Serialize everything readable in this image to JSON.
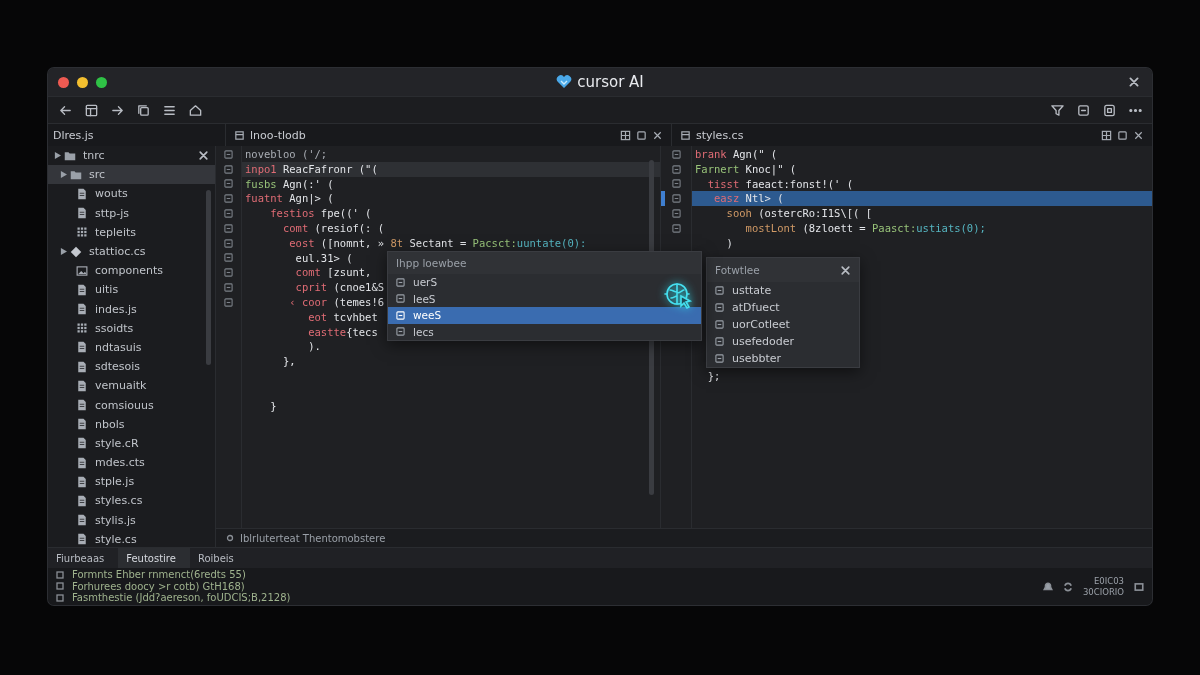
{
  "window": {
    "title": "cursor AI"
  },
  "sidebar": {
    "title": "Dlres.js",
    "tree": [
      {
        "label": "tnrc",
        "kind": "folder",
        "selected": false,
        "closable": true,
        "children": [
          {
            "label": "src",
            "kind": "folder",
            "selected": true,
            "children": [
              {
                "label": "wouts",
                "kind": "file",
                "selected": false
              },
              {
                "label": "sttp-js",
                "kind": "file",
                "selected": false
              },
              {
                "label": "tepleits",
                "kind": "grid",
                "selected": false
              }
            ]
          },
          {
            "label": "stattioc.cs",
            "kind": "diamond",
            "selected": false,
            "children": [
              {
                "label": "components",
                "kind": "image",
                "selected": false
              },
              {
                "label": "uitis",
                "kind": "file",
                "selected": false
              },
              {
                "label": "indes.js",
                "kind": "file",
                "selected": false
              },
              {
                "label": "ssoidts",
                "kind": "grid",
                "selected": false
              },
              {
                "label": "ndtasuis",
                "kind": "file",
                "selected": false
              },
              {
                "label": "sdtesois",
                "kind": "file",
                "selected": false
              },
              {
                "label": "vemuaitk",
                "kind": "file",
                "selected": false
              },
              {
                "label": "comsiouus",
                "kind": "file",
                "selected": false
              },
              {
                "label": "nbols",
                "kind": "file",
                "selected": false
              },
              {
                "label": "style.cR",
                "kind": "file",
                "selected": false
              },
              {
                "label": "mdes.cts",
                "kind": "file",
                "selected": false
              },
              {
                "label": "stple.js",
                "kind": "file",
                "selected": false
              },
              {
                "label": "styles.cs",
                "kind": "file",
                "selected": false
              },
              {
                "label": "stylis.js",
                "kind": "file",
                "selected": false
              },
              {
                "label": "style.cs",
                "kind": "file",
                "selected": false
              }
            ]
          }
        ]
      }
    ]
  },
  "editors": [
    {
      "tab": "lnoo-tlodb",
      "focused": false,
      "lines": [
        {
          "marker": true,
          "current": false,
          "tokens": [
            {
              "t": "novebloo ('/;",
              "kind": "dim"
            }
          ]
        },
        {
          "marker": true,
          "current": true,
          "tokens": [
            {
              "t": "inpo1 ",
              "kind": "kw"
            },
            {
              "t": "ReacFafronr (\"(",
              "kind": "name"
            }
          ]
        },
        {
          "marker": true,
          "current": false,
          "tokens": [
            {
              "t": "fusbs ",
              "kind": "fn"
            },
            {
              "t": "Agn(:' (",
              "kind": "name"
            }
          ]
        },
        {
          "marker": true,
          "current": false,
          "tokens": [
            {
              "t": "fuatnt ",
              "kind": "kw"
            },
            {
              "t": "Agn|> (",
              "kind": "name"
            }
          ]
        },
        {
          "marker": true,
          "current": false,
          "tokens": [
            {
              "t": "    festios ",
              "kind": "kw"
            },
            {
              "t": "fpe((' (",
              "kind": "name"
            }
          ]
        },
        {
          "marker": true,
          "current": false,
          "tokens": [
            {
              "t": "      comt ",
              "kind": "kw"
            },
            {
              "t": "(resiof(: (",
              "kind": "name"
            }
          ]
        },
        {
          "marker": true,
          "current": false,
          "tokens": [
            {
              "t": "       eost ",
              "kind": "kw"
            },
            {
              "t": "([nomnt, » ",
              "kind": "name"
            },
            {
              "t": "8t ",
              "kind": "or"
            },
            {
              "t": "Sectant = ",
              "kind": "name"
            },
            {
              "t": "Pacsct:",
              "kind": "fn"
            },
            {
              "t": "uuntate(0):",
              "kind": "call"
            }
          ]
        },
        {
          "marker": true,
          "current": false,
          "tokens": [
            {
              "t": "        eul.31> (",
              "kind": "name"
            }
          ]
        },
        {
          "marker": true,
          "current": false,
          "tokens": [
            {
              "t": "        comt ",
              "kind": "kw"
            },
            {
              "t": "[zsunt,",
              "kind": "name"
            }
          ]
        },
        {
          "marker": true,
          "current": false,
          "tokens": [
            {
              "t": "        cprit ",
              "kind": "kw"
            },
            {
              "t": "(cnoe1&S",
              "kind": "name"
            }
          ]
        },
        {
          "marker": true,
          "current": false,
          "tokens": [
            {
              "t": "       ‹ coor ",
              "kind": "kw"
            },
            {
              "t": "(temes!6",
              "kind": "name"
            }
          ]
        },
        {
          "marker": false,
          "current": false,
          "tokens": [
            {
              "t": "          eot ",
              "kind": "kw"
            },
            {
              "t": "tcvhbet",
              "kind": "name"
            }
          ]
        },
        {
          "marker": false,
          "current": false,
          "tokens": [
            {
              "t": "          eastte",
              "kind": "kw"
            },
            {
              "t": "{tecs",
              "kind": "name"
            }
          ]
        },
        {
          "marker": false,
          "current": false,
          "tokens": [
            {
              "t": "          ).",
              "kind": "name"
            }
          ]
        },
        {
          "marker": false,
          "current": false,
          "tokens": [
            {
              "t": "      },",
              "kind": "name"
            }
          ]
        },
        {
          "marker": false,
          "current": false
        },
        {
          "marker": false,
          "current": false
        },
        {
          "marker": false,
          "current": false,
          "tokens": [
            {
              "t": "    }",
              "kind": "name"
            }
          ]
        }
      ],
      "popup": {
        "title": "Ihpp loewbee",
        "items": [
          {
            "label": "uerS",
            "selected": false
          },
          {
            "label": "leeS",
            "selected": false
          },
          {
            "label": "weeS",
            "selected": true
          },
          {
            "label": "lecs",
            "selected": false
          }
        ]
      }
    },
    {
      "tab": "styles.cs",
      "focused": true,
      "lines": [
        {
          "marker": true,
          "current": false,
          "tokens": [
            {
              "t": "brank ",
              "kind": "kw"
            },
            {
              "t": "Agn(\" (",
              "kind": "name"
            }
          ]
        },
        {
          "marker": true,
          "current": false,
          "tokens": [
            {
              "t": "Farnert ",
              "kind": "fn"
            },
            {
              "t": "Knoc|\" (",
              "kind": "name"
            }
          ]
        },
        {
          "marker": true,
          "current": false,
          "tokens": [
            {
              "t": "  tisst ",
              "kind": "kw"
            },
            {
              "t": "faeact:fonst!(' (",
              "kind": "name"
            }
          ]
        },
        {
          "marker": true,
          "current": true,
          "tokens": [
            {
              "t": "   easz ",
              "kind": "kw"
            },
            {
              "t": "Ntl> (",
              "kind": "name"
            }
          ]
        },
        {
          "marker": true,
          "current": false,
          "tokens": [
            {
              "t": "     sooh ",
              "kind": "or"
            },
            {
              "t": "(ostercRo:I1S\\[( [",
              "kind": "name"
            }
          ]
        },
        {
          "marker": true,
          "current": false,
          "tokens": [
            {
              "t": "        mostLont ",
              "kind": "or"
            },
            {
              "t": "(8zloett = ",
              "kind": "name"
            },
            {
              "t": "Paasct:",
              "kind": "fn"
            },
            {
              "t": "ustiats(0);",
              "kind": "call"
            }
          ]
        },
        {
          "marker": false,
          "current": false,
          "tokens": [
            {
              "t": "     )",
              "kind": "name"
            }
          ]
        },
        {
          "current": false
        },
        {
          "current": false
        },
        {
          "current": false
        },
        {
          "current": false
        },
        {
          "current": false
        },
        {
          "current": false
        },
        {
          "marker": false,
          "current": false
        },
        {
          "marker": false,
          "current": false
        },
        {
          "marker": false,
          "current": false,
          "tokens": [
            {
              "t": "  };",
              "kind": "name"
            }
          ]
        }
      ],
      "popup": {
        "title": "Fotwtlee",
        "items": [
          {
            "label": "usttate",
            "selected": false
          },
          {
            "label": "atDfuect",
            "selected": false
          },
          {
            "label": "uorCotleet",
            "selected": false
          },
          {
            "label": "usefedoder",
            "selected": false
          },
          {
            "label": "usebbter",
            "selected": false
          }
        ]
      }
    }
  ],
  "editor_status": "Iblrluterteat Thentomobstere",
  "panel": {
    "tabs": [
      {
        "label": "Fiurbeaas",
        "selected": false
      },
      {
        "label": "Feutostire",
        "selected": true
      },
      {
        "label": "Roibeis",
        "selected": false
      }
    ],
    "lines": [
      "Formnts Ehber rnmenct(6redts 55)",
      "Forhurees doocy >r cotb) GtH168)",
      "Fasmthestie (Jdd?aereson, foUDCIS;B,2128)"
    ],
    "status": [
      "E0IC03",
      "30CIORIO"
    ]
  }
}
